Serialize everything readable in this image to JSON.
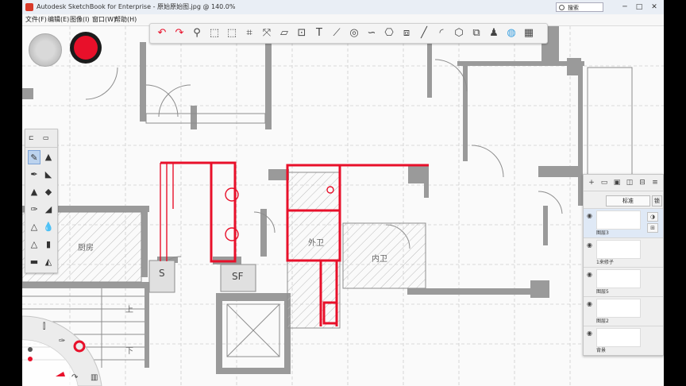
{
  "window": {
    "title": "Autodesk SketchBook for Enterprise - 原始原始图.jpg @ 140.0%"
  },
  "menu": [
    "文件(F)",
    "编辑(E)",
    "图像(I)",
    "窗口(W)",
    "帮助(H)"
  ],
  "search": {
    "placeholder": "搜索"
  },
  "window_controls": {
    "minimize": "─",
    "maximize": "□",
    "close": "✕"
  },
  "colors": {
    "accent_red": "#e8102a",
    "selection_blue": "#bcd3ee",
    "toolbar_bg": "#f4f4f4"
  },
  "toolbar": {
    "tools": [
      {
        "name": "undo-icon",
        "glyph": "↶"
      },
      {
        "name": "redo-icon",
        "glyph": "↷"
      },
      {
        "name": "zoom-icon",
        "glyph": "⚲"
      },
      {
        "name": "select-icon",
        "glyph": "⬚"
      },
      {
        "name": "lasso-select-icon",
        "glyph": "⬚"
      },
      {
        "name": "crop-icon",
        "glyph": "⌗"
      },
      {
        "name": "transform-icon",
        "glyph": "⤧"
      },
      {
        "name": "distort-icon",
        "glyph": "▱"
      },
      {
        "name": "fill-icon",
        "glyph": "⊡"
      },
      {
        "name": "text-icon",
        "glyph": "T"
      },
      {
        "name": "ruler-icon",
        "glyph": "⟋"
      },
      {
        "name": "ellipse-guide-icon",
        "glyph": "◎"
      },
      {
        "name": "french-curve-icon",
        "glyph": "∽"
      },
      {
        "name": "symmetry-icon",
        "glyph": "⎔"
      },
      {
        "name": "perspective-icon",
        "glyph": "⧈"
      },
      {
        "name": "line-icon",
        "glyph": "╱"
      },
      {
        "name": "curve-icon",
        "glyph": "◜"
      },
      {
        "name": "shape-icon",
        "glyph": "⬡"
      },
      {
        "name": "layer-editor-icon",
        "glyph": "⧉"
      },
      {
        "name": "brush-library-icon",
        "glyph": "♟"
      },
      {
        "name": "color-wheel-icon",
        "glyph": "◍"
      },
      {
        "name": "copic-library-icon",
        "glyph": "▦"
      }
    ]
  },
  "brush_palette": {
    "cells": [
      {
        "name": "pencil-icon",
        "glyph": "✎",
        "selected": true
      },
      {
        "name": "marker-icon",
        "glyph": "▲"
      },
      {
        "name": "ink-pen-icon",
        "glyph": "✒"
      },
      {
        "name": "brush-icon",
        "glyph": "◣"
      },
      {
        "name": "airbrush-icon",
        "glyph": "▲"
      },
      {
        "name": "chisel-icon",
        "glyph": "◆"
      },
      {
        "name": "pen-icon",
        "glyph": "✑"
      },
      {
        "name": "paint-icon",
        "glyph": "◢"
      },
      {
        "name": "triangle-brush-icon",
        "glyph": "△"
      },
      {
        "name": "droplet-icon",
        "glyph": "💧"
      },
      {
        "name": "smear-icon",
        "glyph": "△"
      },
      {
        "name": "eraser-icon",
        "glyph": "▮"
      },
      {
        "name": "hard-eraser-icon",
        "glyph": "▬"
      },
      {
        "name": "soft-eraser-icon",
        "glyph": "◭"
      }
    ]
  },
  "floor_plan_labels": {
    "kitchen": "厨房",
    "outer_bath": "外卫",
    "inner_bath": "内卫",
    "shaft_s": "S",
    "shaft_sf": "SF",
    "up": "上",
    "down": "下"
  },
  "layers_panel": {
    "blend_mode": "标准",
    "lock_label": "锁",
    "tools": [
      "+",
      "▭",
      "▣",
      "◫",
      "⊟",
      "≡"
    ],
    "layers": [
      {
        "name": "图层3",
        "selected": true
      },
      {
        "name": "1来修子"
      },
      {
        "name": "图层5"
      },
      {
        "name": "图层2"
      },
      {
        "name": "背景"
      }
    ]
  }
}
